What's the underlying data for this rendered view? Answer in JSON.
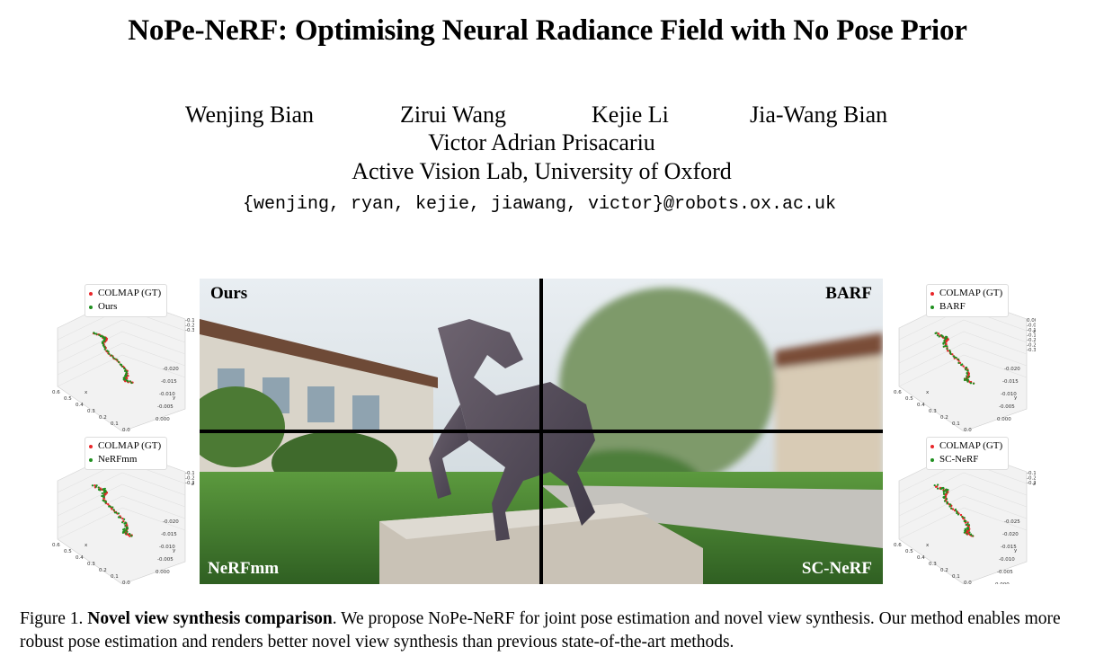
{
  "paper": {
    "title": "NoPe-NeRF: Optimising Neural Radiance Field with No Pose Prior",
    "authors": [
      "Wenjing Bian",
      "Zirui Wang",
      "Kejie Li",
      "Jia-Wang Bian",
      "Victor Adrian Prisacariu"
    ],
    "affiliation": "Active Vision Lab, University of Oxford",
    "email": "{wenjing, ryan, kejie, jiawang, victor}@robots.ox.ac.uk"
  },
  "figure": {
    "quadrant_labels": {
      "top_left": "Ours",
      "top_right": "BARF",
      "bottom_left": "NeRFmm",
      "bottom_right": "SC-NeRF"
    },
    "plots": [
      {
        "legend": [
          "COLMAP (GT)",
          "Ours"
        ],
        "z_ticks": [
          "-0.1",
          "-0.2",
          "-0.3"
        ],
        "y_ticks": [
          "-0.020",
          "-0.015",
          "-0.010",
          "-0.005",
          "0.000"
        ],
        "x_ticks": [
          "0.6",
          "0.5",
          "0.4",
          "0.3",
          "0.2",
          "0.1",
          "0.0"
        ],
        "x_label": "x",
        "y_label": "y",
        "z_label": ""
      },
      {
        "legend": [
          "COLMAP (GT)",
          "BARF"
        ],
        "z_ticks": [
          "0.00",
          "-0.05",
          "-0.10",
          "-0.15",
          "-0.20",
          "-0.25",
          "-0.30"
        ],
        "y_ticks": [
          "-0.020",
          "-0.015",
          "-0.010",
          "-0.005",
          "0.000"
        ],
        "x_ticks": [
          "0.6",
          "0.5",
          "0.4",
          "0.3",
          "0.2",
          "0.1",
          "0.0"
        ],
        "x_label": "x",
        "y_label": "y",
        "z_label": "z"
      },
      {
        "legend": [
          "COLMAP (GT)",
          "NeRFmm"
        ],
        "z_ticks": [
          "-0.1",
          "-0.2",
          "-0.3"
        ],
        "y_ticks": [
          "-0.020",
          "-0.015",
          "-0.010",
          "-0.005",
          "0.000"
        ],
        "x_ticks": [
          "0.6",
          "0.5",
          "0.4",
          "0.3",
          "0.2",
          "0.1",
          "0.0"
        ],
        "x_label": "x",
        "y_label": "y",
        "z_label": "z"
      },
      {
        "legend": [
          "COLMAP (GT)",
          "SC-NeRF"
        ],
        "z_ticks": [
          "-0.1",
          "-0.2",
          "-0.3"
        ],
        "y_ticks": [
          "-0.025",
          "-0.020",
          "-0.015",
          "-0.010",
          "-0.005",
          "0.000"
        ],
        "x_ticks": [
          "0.6",
          "0.5",
          "0.4",
          "0.3",
          "0.2",
          "0.1",
          "0.0"
        ],
        "x_label": "x",
        "y_label": "y",
        "z_label": "z"
      }
    ],
    "colors": {
      "gt": "#e8262a",
      "pred": "#1f8f1f"
    }
  },
  "caption": {
    "prefix": "Figure 1.",
    "bold": "Novel view synthesis comparison",
    "text": ". We propose NoPe-NeRF for joint pose estimation and novel view synthesis. Our method enables more robust pose estimation and renders better novel view synthesis than previous state-of-the-art methods."
  }
}
